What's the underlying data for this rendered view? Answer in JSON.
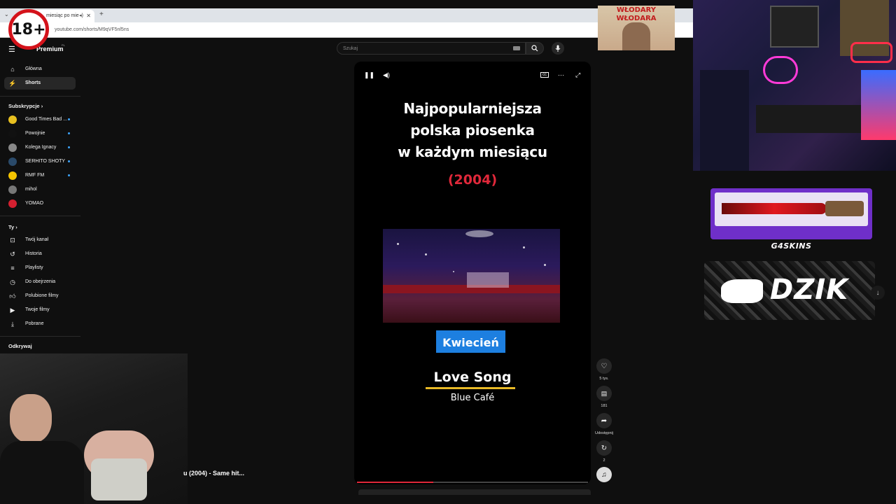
{
  "badge": "18+",
  "browser": {
    "tab_title": "miesiąc po mie",
    "url": "youtube.com/shorts/M9qVF5nl5ns"
  },
  "header": {
    "logo": "Premium",
    "logo_sup": "PL",
    "search_placeholder": "Szukaj"
  },
  "sidebar": {
    "main": [
      {
        "label": "Główna"
      },
      {
        "label": "Shorts"
      }
    ],
    "subs_title": "Subskrypcje",
    "subscriptions": [
      {
        "label": "Good Times Bad ...",
        "color": "#e8c020",
        "dot": true
      },
      {
        "label": "Powojnie",
        "color": "#111111",
        "dot": true
      },
      {
        "label": "Kolega Ignacy",
        "color": "#888888",
        "dot": true
      },
      {
        "label": "SERHITO SHOTY",
        "color": "#2a4a6a",
        "dot": true
      },
      {
        "label": "RMF FM",
        "color": "#f5c400",
        "dot": true
      },
      {
        "label": "mihol",
        "color": "#777777",
        "dot": false
      },
      {
        "label": "YOMAO",
        "color": "#d42030",
        "dot": false
      }
    ],
    "you_title": "Ty",
    "you_items": [
      {
        "label": "Twój kanał",
        "icon": "channel-icon"
      },
      {
        "label": "Historia",
        "icon": "history-icon"
      },
      {
        "label": "Playlisty",
        "icon": "playlist-icon"
      },
      {
        "label": "Do obejrzenia",
        "icon": "watch-later-icon"
      },
      {
        "label": "Polubione filmy",
        "icon": "like-icon"
      },
      {
        "label": "Twoje filmy",
        "icon": "video-icon"
      },
      {
        "label": "Pobrane",
        "icon": "download-icon"
      }
    ],
    "explore_title": "Odkrywaj"
  },
  "short": {
    "heading_lines": [
      "Najpopularniejsza",
      "polska piosenka",
      "w każdym miesiącu"
    ],
    "year": "(2004)",
    "month": "Kwiecień",
    "song": "Love Song",
    "artist": "Blue Café",
    "progress": 0.33,
    "colors": {
      "year": "#e0283a",
      "month_bg": "#1d7fe0",
      "underline": "#e8b926"
    }
  },
  "actions": {
    "likes": "5 tys.",
    "comments": "181",
    "share": "Udostępnij",
    "remix": "2"
  },
  "below_title": "u (2004) - Same hit...",
  "overlays": {
    "poster": [
      "WŁODARY",
      "WŁODARA"
    ],
    "skins": "G4SKINS",
    "dzik": "DZIK"
  }
}
